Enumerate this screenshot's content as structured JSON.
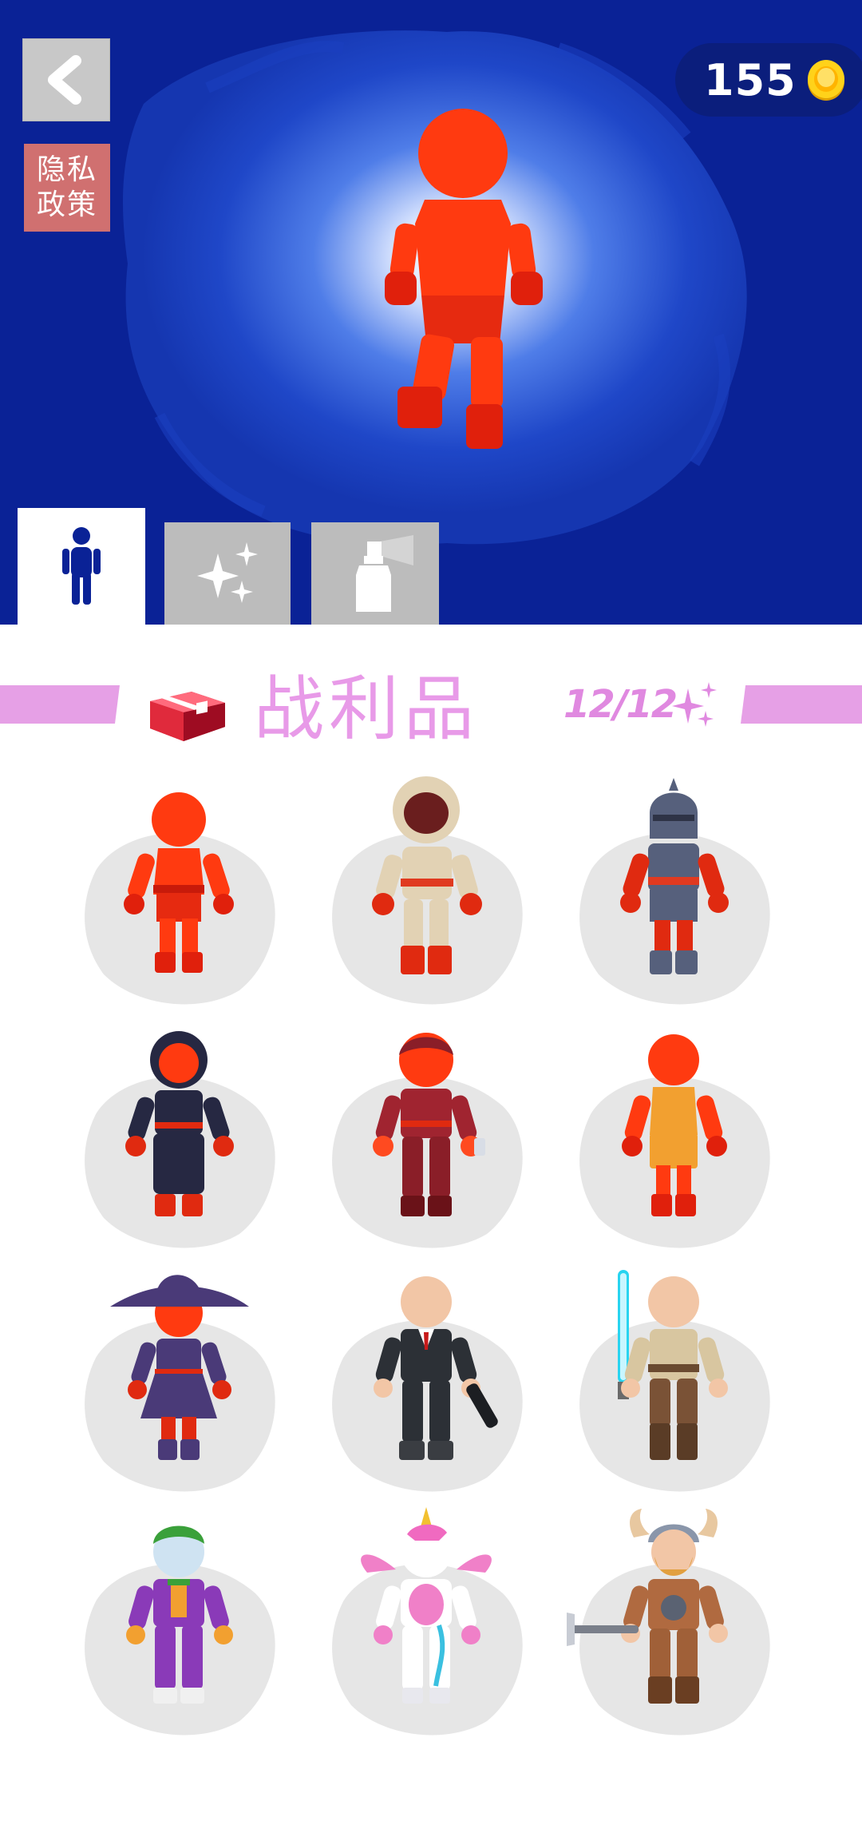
{
  "header": {
    "back_icon": "chevron-left-icon",
    "privacy_line1": "隐私",
    "privacy_line2": "政策",
    "coins": "155",
    "coin_icon": "gold-coin-icon",
    "selected_character": "red-stickman"
  },
  "tabs": [
    {
      "id": "character",
      "icon": "person-icon",
      "selected": true
    },
    {
      "id": "effects",
      "icon": "sparkles-icon",
      "selected": false
    },
    {
      "id": "spray",
      "icon": "spray-bottle-icon",
      "selected": false
    }
  ],
  "loot": {
    "title": "战利品",
    "count": "12/12",
    "chest_icon": "treasure-chest-icon",
    "sparkle_icon": "sparkles-icon"
  },
  "skins": [
    {
      "name": "red-stickman"
    },
    {
      "name": "astronaut"
    },
    {
      "name": "knight"
    },
    {
      "name": "ninja"
    },
    {
      "name": "maroon-fighter"
    },
    {
      "name": "basketball-player"
    },
    {
      "name": "witch"
    },
    {
      "name": "agent-in-suit"
    },
    {
      "name": "jedi"
    },
    {
      "name": "joker"
    },
    {
      "name": "unicorn"
    },
    {
      "name": "viking"
    }
  ],
  "colors": {
    "hero_bg": "#0a2296",
    "loot_pink": "#e89ae8",
    "tab_inactive": "#bcbcbc",
    "accent_red": "#ff3a10"
  }
}
